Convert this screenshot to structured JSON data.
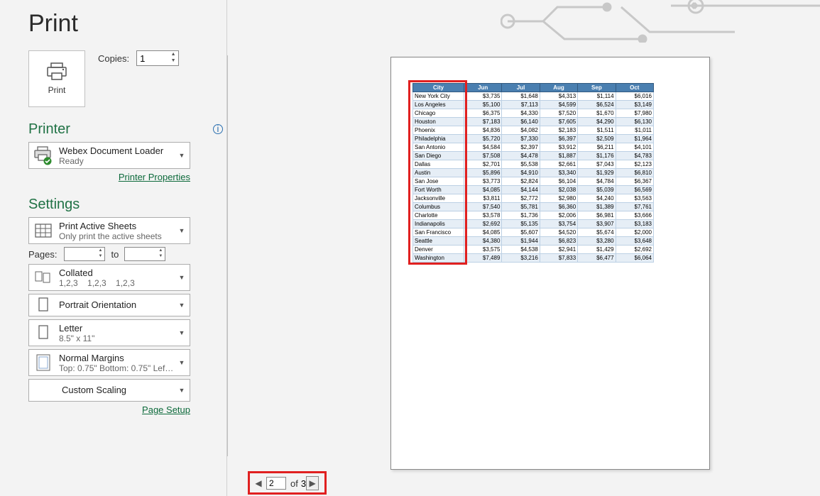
{
  "title": "Print",
  "print_button_label": "Print",
  "copies": {
    "label": "Copies:",
    "value": "1"
  },
  "printer": {
    "section_title": "Printer",
    "name": "Webex Document Loader",
    "status": "Ready",
    "properties_link": "Printer Properties"
  },
  "settings": {
    "section_title": "Settings",
    "print_what": {
      "title": "Print Active Sheets",
      "sub": "Only print the active sheets"
    },
    "pages": {
      "label": "Pages:",
      "from": "",
      "to_word": "to",
      "to": ""
    },
    "collate": {
      "title": "Collated",
      "sub": "1,2,3    1,2,3    1,2,3"
    },
    "orientation": {
      "title": "Portrait Orientation"
    },
    "paper": {
      "title": "Letter",
      "sub": "8.5\" x 11\""
    },
    "margins": {
      "title": "Normal Margins",
      "sub": "Top: 0.75\" Bottom: 0.75\" Lef…"
    },
    "scaling": {
      "title": "Custom Scaling"
    },
    "page_setup_link": "Page Setup"
  },
  "pager": {
    "current": "2",
    "of_word": "of",
    "total": "3"
  },
  "chart_data": {
    "type": "table",
    "columns": [
      "City",
      "Jun",
      "Jul",
      "Aug",
      "Sep",
      "Oct"
    ],
    "rows": [
      [
        "New York City",
        "$3,735",
        "$1,648",
        "$4,313",
        "$1,114",
        "$6,016"
      ],
      [
        "Los Angeles",
        "$5,100",
        "$7,113",
        "$4,599",
        "$6,524",
        "$3,149"
      ],
      [
        "Chicago",
        "$6,375",
        "$4,330",
        "$7,520",
        "$1,670",
        "$7,980"
      ],
      [
        "Houston",
        "$7,183",
        "$6,140",
        "$7,605",
        "$4,290",
        "$6,130"
      ],
      [
        "Phoenix",
        "$4,836",
        "$4,082",
        "$2,183",
        "$1,511",
        "$1,011"
      ],
      [
        "Philadelphia",
        "$5,720",
        "$7,330",
        "$6,397",
        "$2,509",
        "$1,964"
      ],
      [
        "San Antonio",
        "$4,584",
        "$2,397",
        "$3,912",
        "$6,211",
        "$4,101"
      ],
      [
        "San Diego",
        "$7,508",
        "$4,478",
        "$1,887",
        "$1,176",
        "$4,783"
      ],
      [
        "Dallas",
        "$2,701",
        "$5,538",
        "$2,661",
        "$7,043",
        "$2,123"
      ],
      [
        "Austin",
        "$5,896",
        "$4,910",
        "$3,340",
        "$1,929",
        "$6,810"
      ],
      [
        "San Jose",
        "$3,773",
        "$2,824",
        "$6,104",
        "$4,784",
        "$6,367"
      ],
      [
        "Fort Worth",
        "$4,085",
        "$4,144",
        "$2,038",
        "$5,039",
        "$6,569"
      ],
      [
        "Jacksonville",
        "$3,811",
        "$2,772",
        "$2,980",
        "$4,240",
        "$3,563"
      ],
      [
        "Columbus",
        "$7,540",
        "$5,781",
        "$6,360",
        "$1,389",
        "$7,761"
      ],
      [
        "Charlotte",
        "$3,578",
        "$1,736",
        "$2,006",
        "$6,981",
        "$3,666"
      ],
      [
        "Indianapolis",
        "$2,692",
        "$5,135",
        "$3,754",
        "$3,907",
        "$3,183"
      ],
      [
        "San Francisco",
        "$4,085",
        "$5,607",
        "$4,520",
        "$5,674",
        "$2,000"
      ],
      [
        "Seattle",
        "$4,380",
        "$1,944",
        "$6,823",
        "$3,280",
        "$3,648"
      ],
      [
        "Denver",
        "$3,575",
        "$4,538",
        "$2,941",
        "$1,429",
        "$2,692"
      ],
      [
        "Washington",
        "$7,489",
        "$3,216",
        "$7,833",
        "$6,477",
        "$6,064"
      ]
    ]
  }
}
